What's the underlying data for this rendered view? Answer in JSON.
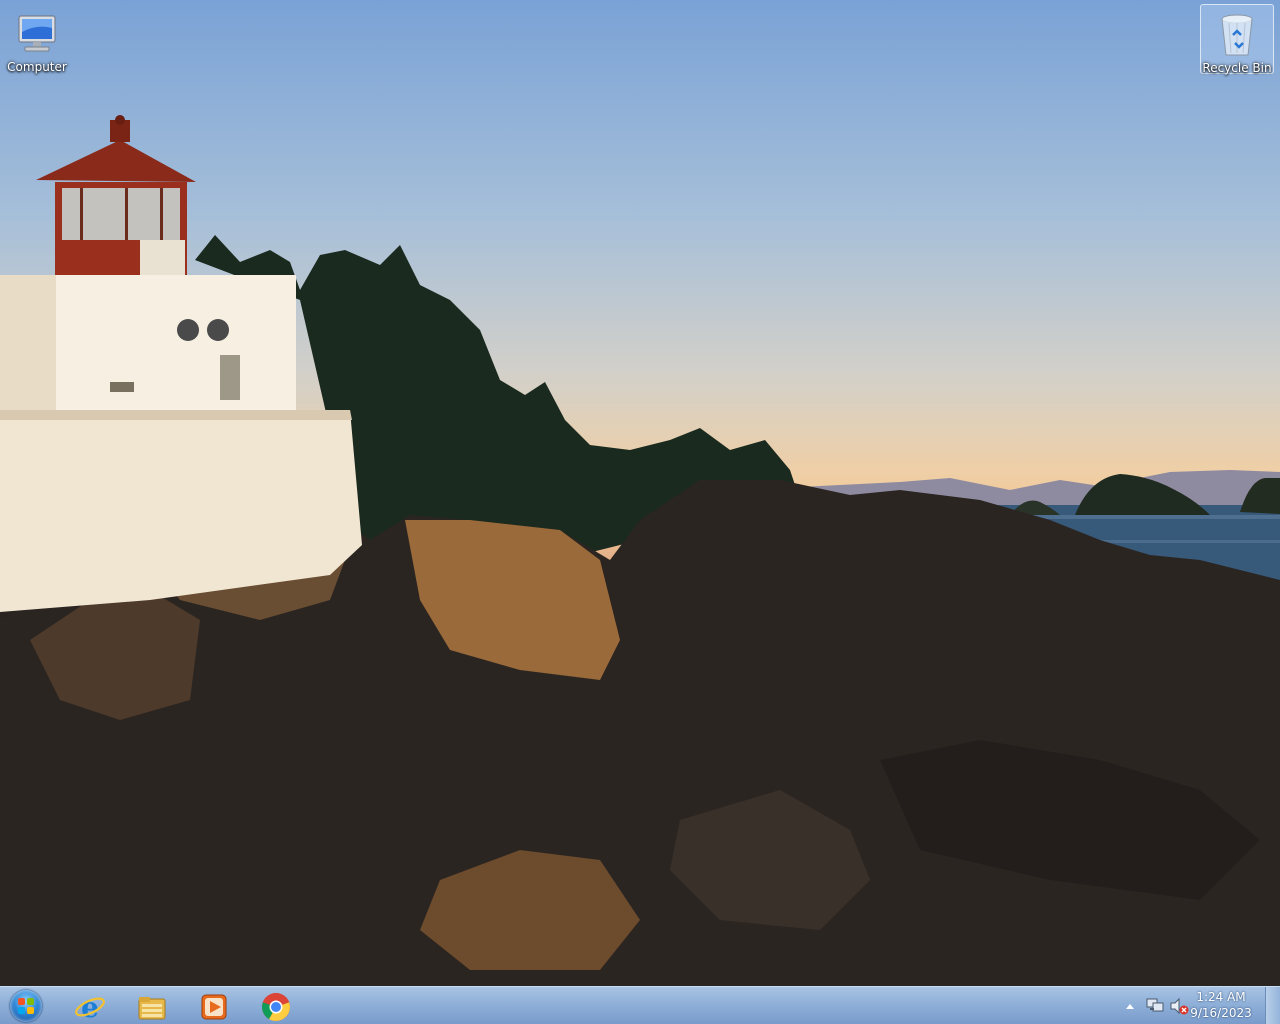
{
  "desktop": {
    "icons": [
      {
        "label": "Computer",
        "icon": "computer-icon"
      },
      {
        "label": "Recycle Bin",
        "icon": "recycle-bin-icon"
      }
    ],
    "wallpaper": "lighthouse-at-sunset"
  },
  "taskbar": {
    "start": {
      "icon": "windows-logo-icon"
    },
    "pinned": [
      {
        "name": "Internet Explorer",
        "icon": "internet-explorer-icon"
      },
      {
        "name": "Windows Explorer",
        "icon": "folder-icon"
      },
      {
        "name": "Windows Media Player",
        "icon": "media-player-icon"
      },
      {
        "name": "Google Chrome",
        "icon": "chrome-icon"
      }
    ],
    "tray": {
      "icons": [
        "show-hidden-icons-arrow",
        "network-icon",
        "volume-muted-icon"
      ],
      "time": "1:24 AM",
      "date": "9/16/2023"
    }
  },
  "colors": {
    "taskbar": "#8fb0d8",
    "sky_top": "#7aa2d6",
    "sunset": "#f2c08e"
  }
}
